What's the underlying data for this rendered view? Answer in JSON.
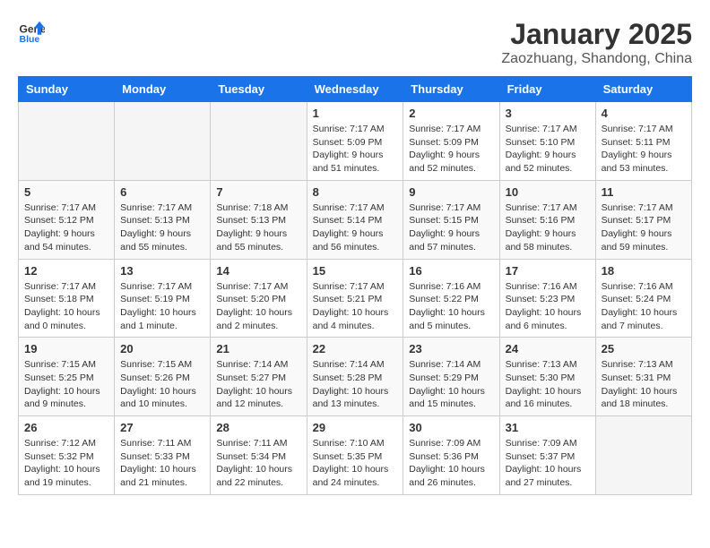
{
  "logo": {
    "general": "General",
    "blue": "Blue"
  },
  "header": {
    "title": "January 2025",
    "subtitle": "Zaozhuang, Shandong, China"
  },
  "days_of_week": [
    "Sunday",
    "Monday",
    "Tuesday",
    "Wednesday",
    "Thursday",
    "Friday",
    "Saturday"
  ],
  "weeks": [
    [
      {
        "day": "",
        "content": ""
      },
      {
        "day": "",
        "content": ""
      },
      {
        "day": "",
        "content": ""
      },
      {
        "day": "1",
        "content": "Sunrise: 7:17 AM\nSunset: 5:09 PM\nDaylight: 9 hours and 51 minutes."
      },
      {
        "day": "2",
        "content": "Sunrise: 7:17 AM\nSunset: 5:09 PM\nDaylight: 9 hours and 52 minutes."
      },
      {
        "day": "3",
        "content": "Sunrise: 7:17 AM\nSunset: 5:10 PM\nDaylight: 9 hours and 52 minutes."
      },
      {
        "day": "4",
        "content": "Sunrise: 7:17 AM\nSunset: 5:11 PM\nDaylight: 9 hours and 53 minutes."
      }
    ],
    [
      {
        "day": "5",
        "content": "Sunrise: 7:17 AM\nSunset: 5:12 PM\nDaylight: 9 hours and 54 minutes."
      },
      {
        "day": "6",
        "content": "Sunrise: 7:17 AM\nSunset: 5:13 PM\nDaylight: 9 hours and 55 minutes."
      },
      {
        "day": "7",
        "content": "Sunrise: 7:18 AM\nSunset: 5:13 PM\nDaylight: 9 hours and 55 minutes."
      },
      {
        "day": "8",
        "content": "Sunrise: 7:17 AM\nSunset: 5:14 PM\nDaylight: 9 hours and 56 minutes."
      },
      {
        "day": "9",
        "content": "Sunrise: 7:17 AM\nSunset: 5:15 PM\nDaylight: 9 hours and 57 minutes."
      },
      {
        "day": "10",
        "content": "Sunrise: 7:17 AM\nSunset: 5:16 PM\nDaylight: 9 hours and 58 minutes."
      },
      {
        "day": "11",
        "content": "Sunrise: 7:17 AM\nSunset: 5:17 PM\nDaylight: 9 hours and 59 minutes."
      }
    ],
    [
      {
        "day": "12",
        "content": "Sunrise: 7:17 AM\nSunset: 5:18 PM\nDaylight: 10 hours and 0 minutes."
      },
      {
        "day": "13",
        "content": "Sunrise: 7:17 AM\nSunset: 5:19 PM\nDaylight: 10 hours and 1 minute."
      },
      {
        "day": "14",
        "content": "Sunrise: 7:17 AM\nSunset: 5:20 PM\nDaylight: 10 hours and 2 minutes."
      },
      {
        "day": "15",
        "content": "Sunrise: 7:17 AM\nSunset: 5:21 PM\nDaylight: 10 hours and 4 minutes."
      },
      {
        "day": "16",
        "content": "Sunrise: 7:16 AM\nSunset: 5:22 PM\nDaylight: 10 hours and 5 minutes."
      },
      {
        "day": "17",
        "content": "Sunrise: 7:16 AM\nSunset: 5:23 PM\nDaylight: 10 hours and 6 minutes."
      },
      {
        "day": "18",
        "content": "Sunrise: 7:16 AM\nSunset: 5:24 PM\nDaylight: 10 hours and 7 minutes."
      }
    ],
    [
      {
        "day": "19",
        "content": "Sunrise: 7:15 AM\nSunset: 5:25 PM\nDaylight: 10 hours and 9 minutes."
      },
      {
        "day": "20",
        "content": "Sunrise: 7:15 AM\nSunset: 5:26 PM\nDaylight: 10 hours and 10 minutes."
      },
      {
        "day": "21",
        "content": "Sunrise: 7:14 AM\nSunset: 5:27 PM\nDaylight: 10 hours and 12 minutes."
      },
      {
        "day": "22",
        "content": "Sunrise: 7:14 AM\nSunset: 5:28 PM\nDaylight: 10 hours and 13 minutes."
      },
      {
        "day": "23",
        "content": "Sunrise: 7:14 AM\nSunset: 5:29 PM\nDaylight: 10 hours and 15 minutes."
      },
      {
        "day": "24",
        "content": "Sunrise: 7:13 AM\nSunset: 5:30 PM\nDaylight: 10 hours and 16 minutes."
      },
      {
        "day": "25",
        "content": "Sunrise: 7:13 AM\nSunset: 5:31 PM\nDaylight: 10 hours and 18 minutes."
      }
    ],
    [
      {
        "day": "26",
        "content": "Sunrise: 7:12 AM\nSunset: 5:32 PM\nDaylight: 10 hours and 19 minutes."
      },
      {
        "day": "27",
        "content": "Sunrise: 7:11 AM\nSunset: 5:33 PM\nDaylight: 10 hours and 21 minutes."
      },
      {
        "day": "28",
        "content": "Sunrise: 7:11 AM\nSunset: 5:34 PM\nDaylight: 10 hours and 22 minutes."
      },
      {
        "day": "29",
        "content": "Sunrise: 7:10 AM\nSunset: 5:35 PM\nDaylight: 10 hours and 24 minutes."
      },
      {
        "day": "30",
        "content": "Sunrise: 7:09 AM\nSunset: 5:36 PM\nDaylight: 10 hours and 26 minutes."
      },
      {
        "day": "31",
        "content": "Sunrise: 7:09 AM\nSunset: 5:37 PM\nDaylight: 10 hours and 27 minutes."
      },
      {
        "day": "",
        "content": ""
      }
    ]
  ]
}
